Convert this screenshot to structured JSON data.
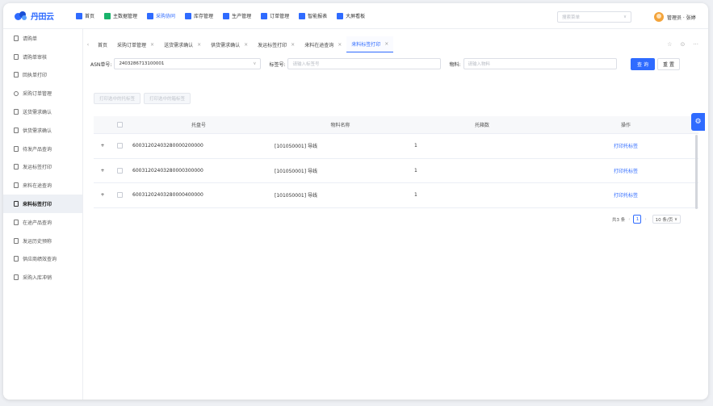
{
  "brand": {
    "logo_text": "丹田云",
    "colors": {
      "primary": "#2f6bff",
      "accent": "#f3a33a"
    }
  },
  "topnav": [
    {
      "label": "首页",
      "icon": "home-icon",
      "color": "#2f6bff",
      "active": false
    },
    {
      "label": "主数据管理",
      "icon": "database-icon",
      "color": "#19b36b",
      "active": false
    },
    {
      "label": "采购协同",
      "icon": "cart-icon",
      "color": "#2f6bff",
      "active": true
    },
    {
      "label": "库存管理",
      "icon": "warehouse-icon",
      "color": "#2f6bff",
      "active": false
    },
    {
      "label": "生产管理",
      "icon": "factory-icon",
      "color": "#2f6bff",
      "active": false
    },
    {
      "label": "订单管理",
      "icon": "order-icon",
      "color": "#2f6bff",
      "active": false
    },
    {
      "label": "智能报表",
      "icon": "report-icon",
      "color": "#2f6bff",
      "active": false
    },
    {
      "label": "大屏看板",
      "icon": "dashboard-icon",
      "color": "#2f6bff",
      "active": false
    }
  ],
  "search": {
    "placeholder": "搜索菜单"
  },
  "user": {
    "label": "管理员 · 张婷"
  },
  "sidebar": [
    {
      "label": "请购单",
      "active": false,
      "icon": "doc-icon"
    },
    {
      "label": "请购单审核",
      "active": false,
      "icon": "doc-icon"
    },
    {
      "label": "回执单打印",
      "active": false,
      "icon": "doc-icon"
    },
    {
      "label": "采购订单管理",
      "active": false,
      "icon": "gear-icon"
    },
    {
      "label": "送货需求确认",
      "active": false,
      "icon": "doc-icon"
    },
    {
      "label": "供货需求确认",
      "active": false,
      "icon": "doc-icon"
    },
    {
      "label": "待发产品查询",
      "active": false,
      "icon": "doc-icon"
    },
    {
      "label": "发运标签打印",
      "active": false,
      "icon": "doc-icon"
    },
    {
      "label": "来料在途查询",
      "active": false,
      "icon": "doc-icon"
    },
    {
      "label": "来料标签打印",
      "active": true,
      "icon": "doc-icon"
    },
    {
      "label": "在途产品查询",
      "active": false,
      "icon": "doc-icon"
    },
    {
      "label": "发运历史预称",
      "active": false,
      "icon": "doc-icon"
    },
    {
      "label": "供应商绩效查询",
      "active": false,
      "icon": "doc-icon"
    },
    {
      "label": "采购入库冲销",
      "active": false,
      "icon": "doc-icon"
    }
  ],
  "tabs": [
    {
      "label": "首页",
      "closable": false,
      "active": false
    },
    {
      "label": "采购订单管理",
      "closable": true,
      "active": false
    },
    {
      "label": "送货需求确认",
      "closable": true,
      "active": false
    },
    {
      "label": "供货需求确认",
      "closable": true,
      "active": false
    },
    {
      "label": "发运标签打印",
      "closable": true,
      "active": false
    },
    {
      "label": "来料在途查询",
      "closable": true,
      "active": false
    },
    {
      "label": "来料标签打印",
      "closable": true,
      "active": true
    }
  ],
  "filter": {
    "asn_label": "ASN单号:",
    "asn_value": "2403286713100001",
    "tag_label": "标签号:",
    "tag_placeholder": "请输入标签号",
    "mat_label": "物料:",
    "mat_placeholder": "请输入物料",
    "query": "查 询",
    "reset": "重 置"
  },
  "actions": {
    "print_selected_pallet": "打印选中的托标签",
    "print_selected_box": "打印选中的箱标签"
  },
  "table": {
    "headers": {
      "pallet": "托盘号",
      "material": "物料名称",
      "boxes": "托箱数",
      "op": "操作"
    },
    "rows": [
      {
        "pallet": "60031202403280000200000",
        "material": "[101050001] 导线",
        "boxes": "1",
        "op": "打印托标签"
      },
      {
        "pallet": "60031202403280000300000",
        "material": "[101050001] 导线",
        "boxes": "1",
        "op": "打印托标签"
      },
      {
        "pallet": "60031202403280000400000",
        "material": "[101050001] 导线",
        "boxes": "1",
        "op": "打印托标签"
      }
    ]
  },
  "pager": {
    "total": "共3 条",
    "page": "1",
    "size": "10 条/页"
  }
}
